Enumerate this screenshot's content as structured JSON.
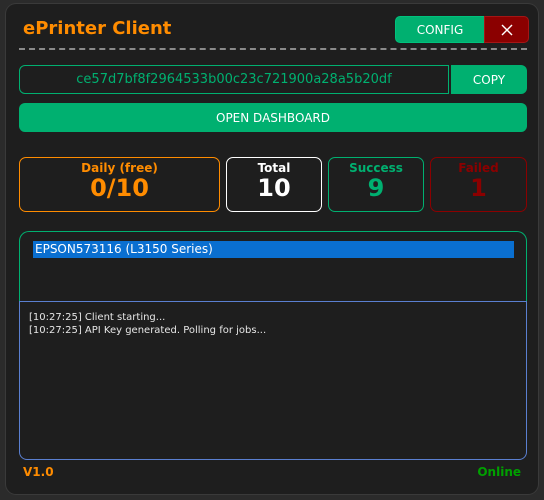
{
  "app": {
    "title": "ePrinter Client"
  },
  "header": {
    "config_label": "CONFIG",
    "close_icon": "close-icon"
  },
  "api_key": {
    "value": "ce57d7bf8f2964533b00c23c721900a28a5b20df",
    "copy_label": "COPY"
  },
  "dashboard": {
    "open_label": "OPEN DASHBOARD"
  },
  "stats": {
    "daily": {
      "label": "Daily (free)",
      "value": "0/10"
    },
    "total": {
      "label": "Total",
      "value": "10"
    },
    "success": {
      "label": "Success",
      "value": "9"
    },
    "failed": {
      "label": "Failed",
      "value": "1"
    }
  },
  "printers": {
    "selected": "EPSON573116 (L3150 Series)"
  },
  "log": {
    "lines": [
      "[10:27:25] Client starting...",
      "[10:27:25] API Key generated. Polling for jobs..."
    ]
  },
  "footer": {
    "version": "V1.0",
    "status": "Online"
  },
  "colors": {
    "accent": "#ff8c00",
    "primary": "#00b070",
    "danger": "#8b0000",
    "selection": "#0a6fd0"
  }
}
